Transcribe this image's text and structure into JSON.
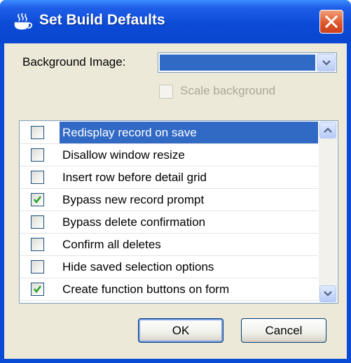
{
  "window": {
    "title": "Set Build Defaults"
  },
  "background": {
    "label": "Background Image:",
    "selected_value": "",
    "scale_label": "Scale background",
    "scale_checked": false,
    "scale_enabled": false
  },
  "options": [
    {
      "label": "Redisplay record on save",
      "checked": false,
      "selected": true
    },
    {
      "label": "Disallow window resize",
      "checked": false,
      "selected": false
    },
    {
      "label": "Insert row before detail grid",
      "checked": false,
      "selected": false
    },
    {
      "label": "Bypass new record prompt",
      "checked": true,
      "selected": false
    },
    {
      "label": "Bypass delete confirmation",
      "checked": false,
      "selected": false
    },
    {
      "label": "Confirm all deletes",
      "checked": false,
      "selected": false
    },
    {
      "label": "Hide saved selection options",
      "checked": false,
      "selected": false
    },
    {
      "label": "Create function buttons on form",
      "checked": true,
      "selected": false
    }
  ],
  "buttons": {
    "ok": "OK",
    "cancel": "Cancel"
  },
  "colors": {
    "titlebar": "#0a4bd6",
    "face": "#ece9d8",
    "selection": "#316ac5",
    "check": "#21a121"
  },
  "icons": {
    "title": "teapot-icon",
    "close": "close-icon",
    "dropdown": "chevron-down-icon"
  }
}
